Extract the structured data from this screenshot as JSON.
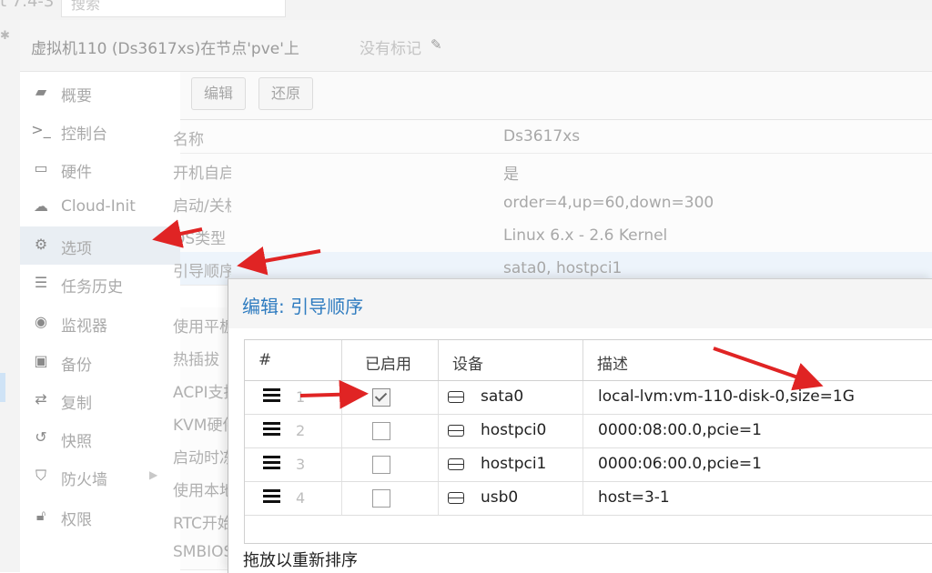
{
  "topbar": {
    "version": "t 7.4-3",
    "search_placeholder": "搜索"
  },
  "header": {
    "title": "虚拟机110 (Ds3617xs)在节点'pve'上",
    "tags": "没有标记"
  },
  "sidebar": {
    "items": [
      {
        "label": "概要",
        "icon": "book-icon"
      },
      {
        "label": "控制台",
        "icon": "terminal-icon"
      },
      {
        "label": "硬件",
        "icon": "desktop-icon"
      },
      {
        "label": "Cloud-Init",
        "icon": "cloud-icon"
      },
      {
        "label": "选项",
        "icon": "gear-icon"
      },
      {
        "label": "任务历史",
        "icon": "list-icon"
      },
      {
        "label": "监视器",
        "icon": "eye-icon"
      },
      {
        "label": "备份",
        "icon": "floppy-icon"
      },
      {
        "label": "复制",
        "icon": "retweet-icon"
      },
      {
        "label": "快照",
        "icon": "history-icon"
      },
      {
        "label": "防火墙",
        "icon": "shield-icon"
      },
      {
        "label": "权限",
        "icon": "unlock-icon"
      }
    ]
  },
  "toolbar": {
    "edit_label": "编辑",
    "revert_label": "还原"
  },
  "options": [
    {
      "key": "名称",
      "value": "Ds3617xs"
    },
    {
      "key": "开机自启动",
      "value": "是"
    },
    {
      "key": "启动/关机顺序",
      "value": "order=4,up=60,down=300"
    },
    {
      "key": "OS类型",
      "value": "Linux 6.x - 2.6 Kernel"
    },
    {
      "key": "引导顺序",
      "value": "sata0, hostpci1"
    },
    {
      "key": "使用平板",
      "value": ""
    },
    {
      "key": "热插拔",
      "value": ""
    },
    {
      "key": "ACPI支持",
      "value": ""
    },
    {
      "key": "KVM硬件",
      "value": ""
    },
    {
      "key": "启动时冻结",
      "value": ""
    },
    {
      "key": "使用本地时间",
      "value": ""
    },
    {
      "key": "RTC开始日期",
      "value": ""
    },
    {
      "key": "SMBIOS",
      "value": ""
    }
  ],
  "dialog": {
    "title": "编辑: 引导顺序",
    "columns": {
      "num": "#",
      "enabled": "已启用",
      "device": "设备",
      "desc": "描述"
    },
    "rows": [
      {
        "num": "1",
        "enabled": true,
        "device": "sata0",
        "desc": "local-lvm:vm-110-disk-0,size=1G"
      },
      {
        "num": "2",
        "enabled": false,
        "device": "hostpci0",
        "desc": "0000:08:00.0,pcie=1"
      },
      {
        "num": "3",
        "enabled": false,
        "device": "hostpci1",
        "desc": "0000:06:00.0,pcie=1"
      },
      {
        "num": "4",
        "enabled": false,
        "device": "usb0",
        "desc": "host=3-1"
      }
    ],
    "footer": "拖放以重新排序"
  },
  "colors": {
    "accent": "#2f7cc0",
    "annotation_arrow": "#e02424"
  }
}
